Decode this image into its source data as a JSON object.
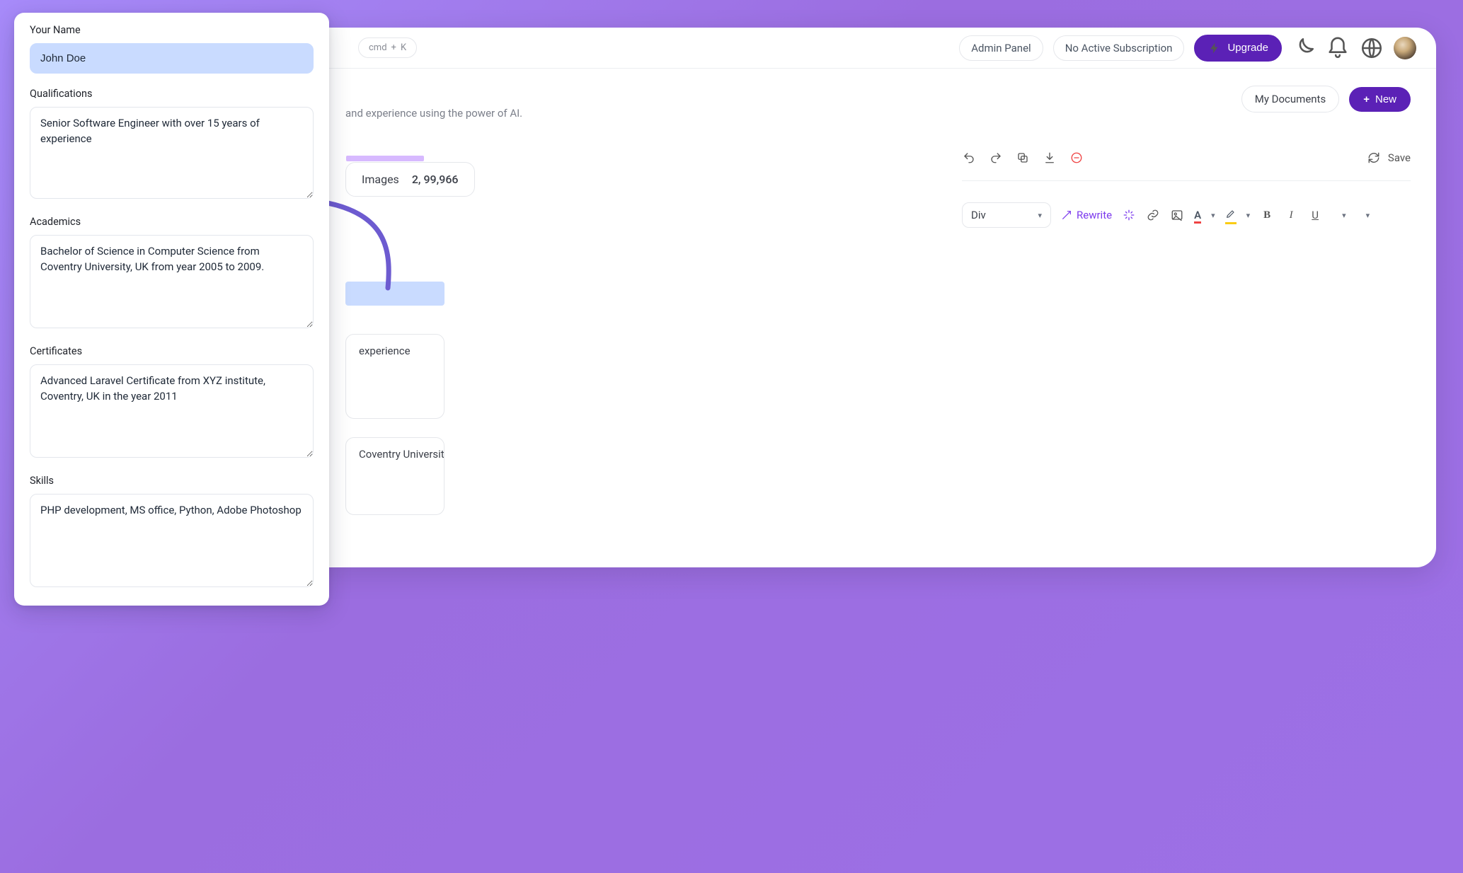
{
  "header": {
    "kbd_cmd": "cmd",
    "kbd_plus": "+",
    "kbd_k": "K",
    "admin_panel": "Admin Panel",
    "subscription": "No Active Subscription",
    "upgrade": "Upgrade"
  },
  "content": {
    "hint_line": "and experience using the power of AI.",
    "stat_label": "Images",
    "stat_value": "2,  99,966",
    "bg_snippet_1": "experience",
    "bg_snippet_2": "Coventry University, UK"
  },
  "right": {
    "my_documents": "My Documents",
    "new": "New",
    "save": "Save",
    "select": "Div",
    "rewrite": "Rewrite"
  },
  "popup": {
    "name_label": "Your Name",
    "name_value": "John Doe",
    "qual_label": "Qualifications",
    "qual_value": "Senior Software Engineer with over 15 years of experience",
    "acad_label": "Academics",
    "acad_value": "Bachelor of Science in Computer Science from Coventry University, UK from year 2005 to 2009.",
    "cert_label": "Certificates",
    "cert_value": "Advanced Laravel Certificate from XYZ institute, Coventry, UK in the year 2011",
    "skills_label": "Skills",
    "skills_value": "PHP development, MS office, Python, Adobe Photoshop"
  }
}
